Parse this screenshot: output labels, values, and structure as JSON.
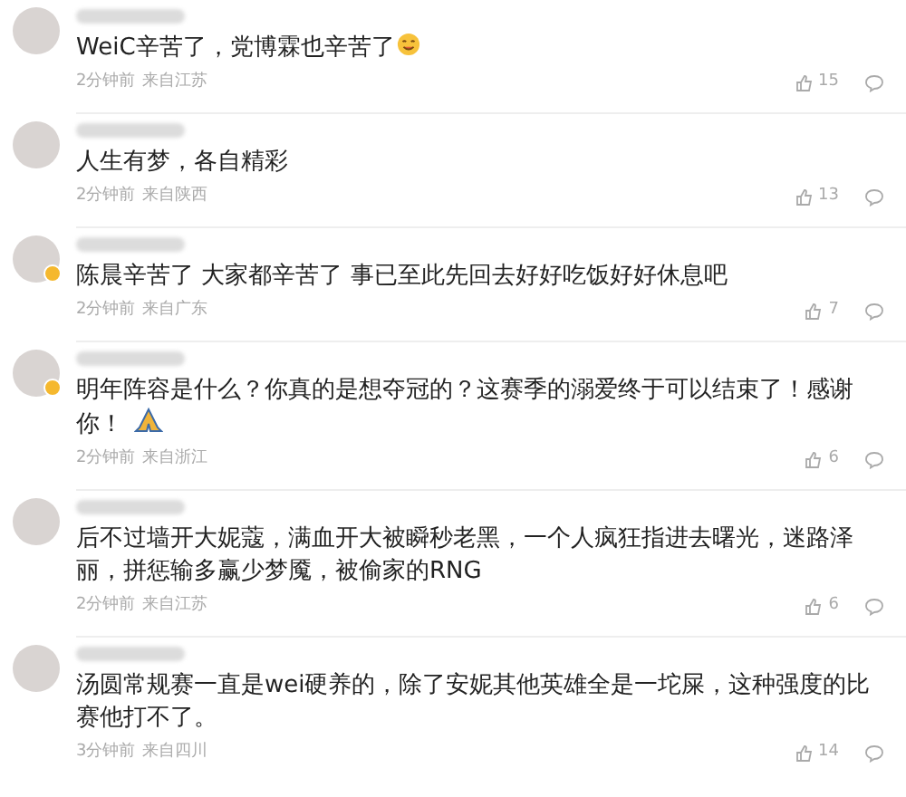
{
  "comments": [
    {
      "verified": false,
      "text": "WeiC辛苦了，党博霖也辛苦了",
      "emoji": {
        "kind": "smile"
      },
      "time": "2分钟前",
      "location": "来自江苏",
      "likes": "15"
    },
    {
      "verified": false,
      "text": "人生有梦，各自精彩",
      "time": "2分钟前",
      "location": "来自陕西",
      "likes": "13"
    },
    {
      "verified": true,
      "text": "陈晨辛苦了 大家都辛苦了 事已至此先回去好好吃饭好好休息吧",
      "time": "2分钟前",
      "location": "来自广东",
      "likes": "7"
    },
    {
      "verified": true,
      "text": "明年阵容是什么？你真的是想夺冠的？这赛季的溺爱终于可以结束了！感谢你！",
      "emoji": {
        "kind": "pray"
      },
      "time": "2分钟前",
      "location": "来自浙江",
      "likes": "6"
    },
    {
      "verified": false,
      "text": "后不过墙开大妮蔻，满血开大被瞬秒老黑，一个人疯狂指进去曙光，迷路泽丽，拼惩输多赢少梦魇，被偷家的RNG",
      "time": "2分钟前",
      "location": "来自江苏",
      "likes": "6"
    },
    {
      "verified": false,
      "text": "汤圆常规赛一直是wei硬养的，除了安妮其他英雄全是一坨屎，这种强度的比赛他打不了。",
      "time": "3分钟前",
      "location": "来自四川",
      "likes": "14"
    }
  ]
}
